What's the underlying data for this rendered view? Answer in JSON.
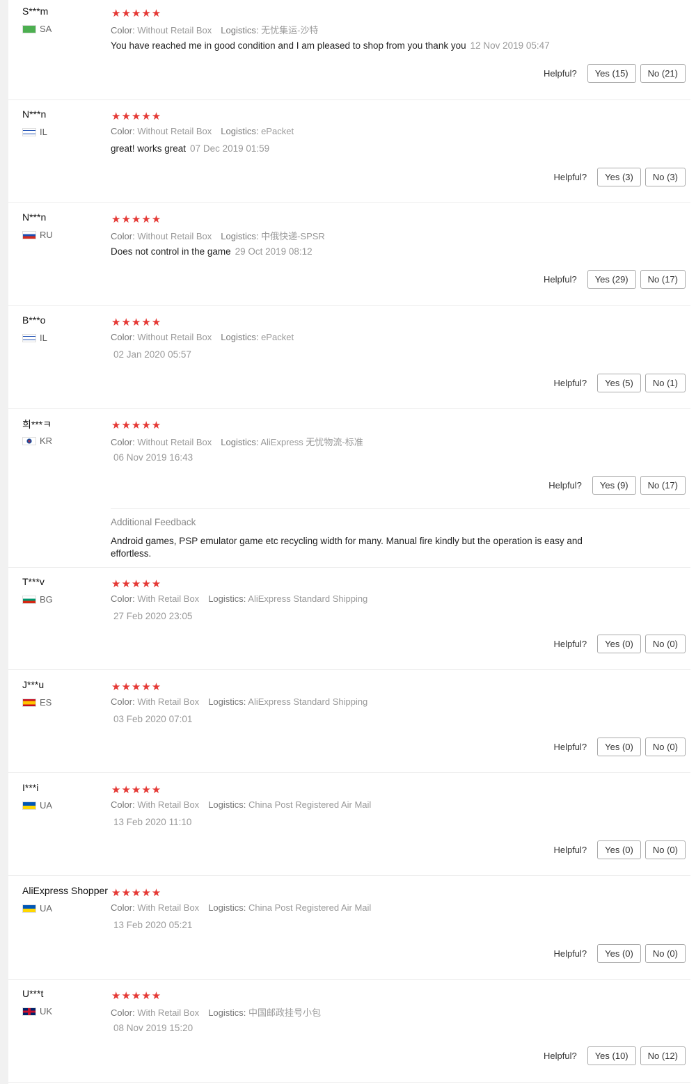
{
  "labels": {
    "color": "Color:",
    "logistics": "Logistics:",
    "helpful": "Helpful?",
    "additional_feedback": "Additional Feedback"
  },
  "stars": "★★★★★",
  "colors": {
    "star": "#e53935",
    "border": "#ececec"
  },
  "reviews": [
    {
      "user": "S***m",
      "country": "SA",
      "color": "Without Retail Box",
      "logistics": "无忧集运-沙特",
      "text": "You have reached me in good condition and I am pleased to shop from you thank you",
      "date": "12 Nov 2019 05:47",
      "yes": "Yes (15)",
      "no": "No (21)"
    },
    {
      "user": "N***n",
      "country": "IL",
      "color": "Without Retail Box",
      "logistics": "ePacket",
      "text": "great! works great",
      "date": "07 Dec 2019 01:59",
      "yes": "Yes (3)",
      "no": "No (3)"
    },
    {
      "user": "N***n",
      "country": "RU",
      "color": "Without Retail Box",
      "logistics": "中俄快递-SPSR",
      "text": "Does not control in the game",
      "date": "29 Oct 2019 08:12",
      "yes": "Yes (29)",
      "no": "No (17)"
    },
    {
      "user": "B***o",
      "country": "IL",
      "color": "Without Retail Box",
      "logistics": "ePacket",
      "text": "",
      "date": "02 Jan 2020 05:57",
      "yes": "Yes (5)",
      "no": "No (1)"
    },
    {
      "user": "희***ㅋ",
      "country": "KR",
      "color": "Without Retail Box",
      "logistics": "AliExpress 无忧物流-标准",
      "text": "",
      "date": "06 Nov 2019 16:43",
      "yes": "Yes (9)",
      "no": "No (17)",
      "additional": "Android games, PSP emulator game etc recycling width for many. Manual fire kindly but the operation is easy and effortless."
    },
    {
      "user": "T***v",
      "country": "BG",
      "color": "With Retail Box",
      "logistics": "AliExpress Standard Shipping",
      "text": "",
      "date": "27 Feb 2020 23:05",
      "yes": "Yes (0)",
      "no": "No (0)"
    },
    {
      "user": "J***u",
      "country": "ES",
      "color": "With Retail Box",
      "logistics": "AliExpress Standard Shipping",
      "text": "",
      "date": "03 Feb 2020 07:01",
      "yes": "Yes (0)",
      "no": "No (0)"
    },
    {
      "user": "I***i",
      "country": "UA",
      "color": "With Retail Box",
      "logistics": "China Post Registered Air Mail",
      "text": "",
      "date": "13 Feb 2020 11:10",
      "yes": "Yes (0)",
      "no": "No (0)"
    },
    {
      "user": "AliExpress Shopper",
      "country": "UA",
      "color": "With Retail Box",
      "logistics": "China Post Registered Air Mail",
      "text": "",
      "date": "13 Feb 2020 05:21",
      "yes": "Yes (0)",
      "no": "No (0)"
    },
    {
      "user": "U***t",
      "country": "UK",
      "color": "With Retail Box",
      "logistics": "中国邮政挂号小包",
      "text": "",
      "date": "08 Nov 2019 15:20",
      "yes": "Yes (10)",
      "no": "No (12)"
    }
  ]
}
